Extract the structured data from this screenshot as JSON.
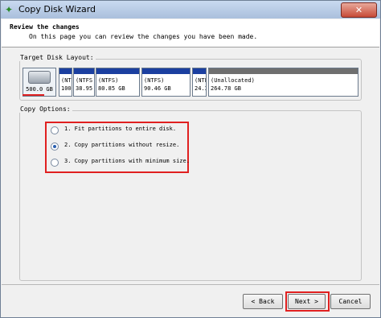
{
  "window": {
    "title": "Copy Disk Wizard",
    "close_label": "✕"
  },
  "header": {
    "title": "Review the changes",
    "subtitle": "On this page you can review the changes you have been made."
  },
  "target_layout": {
    "label": "Target Disk Layout:",
    "disk_size": "500.0 GB",
    "partitions": [
      {
        "l1": "(NT",
        "l2": "100"
      },
      {
        "l1": "(NTFS",
        "l2": "38.95"
      },
      {
        "l1": "(NTFS)",
        "l2": "80.85 GB"
      },
      {
        "l1": "(NTFS)",
        "l2": "90.46 GB"
      },
      {
        "l1": "(NTFS",
        "l2": "24.3"
      },
      {
        "l1": "(Unallocated)",
        "l2": "264.78 GB"
      }
    ]
  },
  "copy_options": {
    "label": "Copy Options:",
    "options": [
      {
        "label": "1. Fit partitions to entire disk.",
        "checked": false
      },
      {
        "label": "2. Copy partitions without resize.",
        "checked": true
      },
      {
        "label": "3. Copy partitions with minimum size.",
        "checked": false
      }
    ]
  },
  "buttons": {
    "back": "< Back",
    "next": "Next >",
    "cancel": "Cancel"
  },
  "colors": {
    "partition_bar": "#1b3fa0",
    "unallocated_bar": "#6f6f6f",
    "highlight": "#e02020"
  }
}
